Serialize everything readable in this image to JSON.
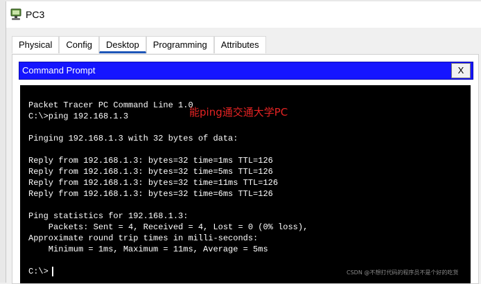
{
  "window": {
    "title": "PC3"
  },
  "tabs": [
    {
      "label": "Physical"
    },
    {
      "label": "Config"
    },
    {
      "label": "Desktop"
    },
    {
      "label": "Programming"
    },
    {
      "label": "Attributes"
    }
  ],
  "active_tab": "Desktop",
  "command_prompt": {
    "title": "Command Prompt",
    "close_label": "X",
    "lines": [
      "Packet Tracer PC Command Line 1.0",
      "C:\\>ping 192.168.1.3",
      "",
      "Pinging 192.168.1.3 with 32 bytes of data:",
      "",
      "Reply from 192.168.1.3: bytes=32 time=1ms TTL=126",
      "Reply from 192.168.1.3: bytes=32 time=5ms TTL=126",
      "Reply from 192.168.1.3: bytes=32 time=11ms TTL=126",
      "Reply from 192.168.1.3: bytes=32 time=6ms TTL=126",
      "",
      "Ping statistics for 192.168.1.3:",
      "    Packets: Sent = 4, Received = 4, Lost = 0 (0% loss),",
      "Approximate round trip times in milli-seconds:",
      "    Minimum = 1ms, Maximum = 11ms, Average = 5ms",
      "",
      "C:\\>"
    ],
    "annotation": "能ping通交通大学PC"
  },
  "watermark": "CSDN @不想打代码的程序员不是个好的吃货",
  "colors": {
    "header_blue": "#1515ff",
    "active_tab_underline": "#1e56b8",
    "annotation_red": "#e52323"
  },
  "icons": {
    "app": "pc-icon"
  }
}
